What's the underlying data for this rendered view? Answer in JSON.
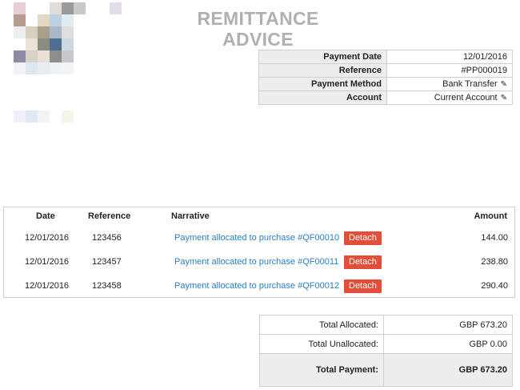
{
  "title": {
    "line1": "REMITTANCE",
    "line2": "ADVICE"
  },
  "meta": [
    {
      "label": "Payment Date",
      "value": "12/01/2016",
      "editable": false
    },
    {
      "label": "Reference",
      "value": "#PP000019",
      "editable": false
    },
    {
      "label": "Payment Method",
      "value": "Bank Transfer",
      "editable": true
    },
    {
      "label": "Account",
      "value": "Current Account",
      "editable": true
    }
  ],
  "allocations": {
    "headers": {
      "date": "Date",
      "reference": "Reference",
      "narrative": "Narrative",
      "amount": "Amount"
    },
    "rows": [
      {
        "date": "12/01/2016",
        "reference": "123456",
        "narrative": "Payment allocated to purchase #QF00010",
        "action": "Detach",
        "amount": "144.00"
      },
      {
        "date": "12/01/2016",
        "reference": "123457",
        "narrative": "Payment allocated to purchase #QF00011",
        "action": "Detach",
        "amount": "238.80"
      },
      {
        "date": "12/01/2016",
        "reference": "123458",
        "narrative": "Payment allocated to purchase #QF00012",
        "action": "Detach",
        "amount": "290.40"
      }
    ]
  },
  "totals": [
    {
      "label": "Total Allocated:",
      "value": "GBP 673.20"
    },
    {
      "label": "Total Unallocated:",
      "value": "GBP 0.00"
    },
    {
      "label": "Total Payment:",
      "value": "GBP 673.20"
    }
  ],
  "colors": {
    "accent_link": "#2a7fc1",
    "detach_button": "#e14f3a",
    "header_bg": "#ededed"
  }
}
